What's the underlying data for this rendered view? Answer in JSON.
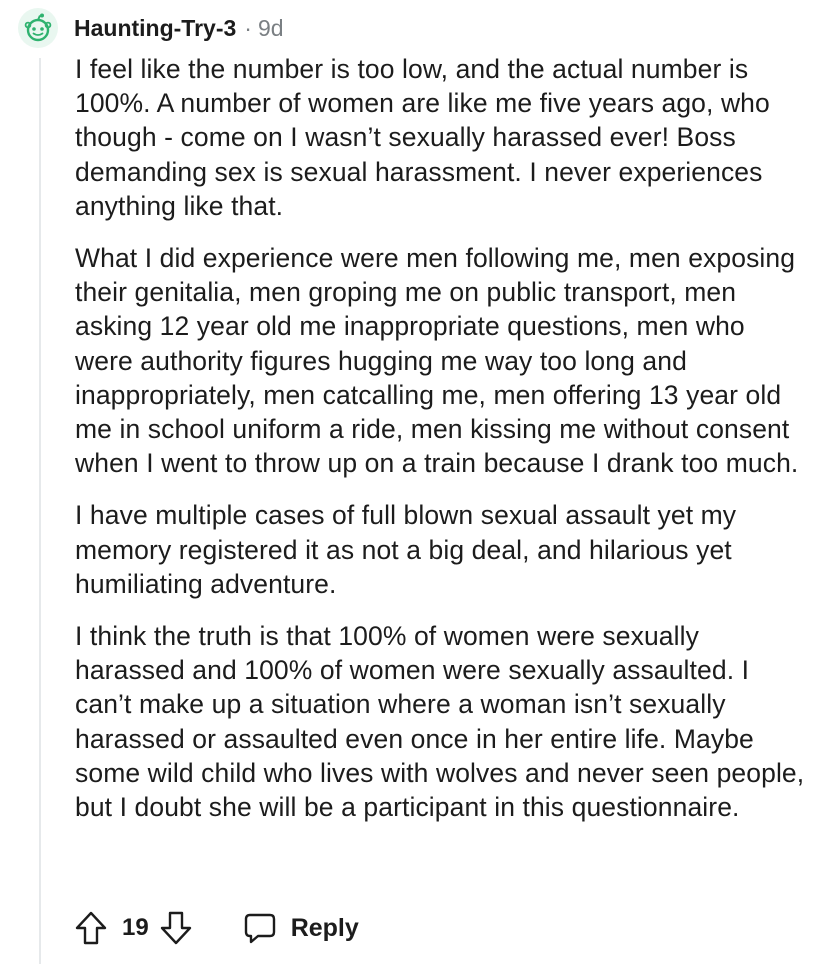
{
  "comment": {
    "author": "Haunting-Try-3",
    "separator": "·",
    "age": "9d",
    "avatar_icon": "snoo-avatar-icon",
    "avatar_color": "#2fb26f",
    "paragraphs": [
      "I feel like the number is too low, and the actual number is 100%. A number of women are like me five years ago, who though - come on I wasn’t sexually harassed ever! Boss demanding sex is sexual harassment. I never experiences anything like that.",
      "What I did experience were men following me, men exposing their genitalia, men groping me on public transport, men asking 12 year old me inappropriate questions, men who were authority figures hugging me way too long and inappropriately, men catcalling me, men offering 13 year old me in school uniform a ride, men kissing me without consent when I went to throw up on a train because I drank too much.",
      "I have multiple cases of full blown sexual assault yet my memory registered it as not a big deal, and hilarious yet humiliating adventure.",
      "I think the truth is that 100% of women were sexually harassed and 100% of women were sexually assaulted. I can’t make up a situation where a woman isn’t sexually harassed or assaulted even once in her entire life. Maybe some wild child who lives with wolves and never seen people, but I doubt she will be a participant in this questionnaire."
    ]
  },
  "actions": {
    "upvote_icon": "arrow-up-icon",
    "score": "19",
    "downvote_icon": "arrow-down-icon",
    "reply_icon": "speech-bubble-icon",
    "reply_label": "Reply"
  }
}
